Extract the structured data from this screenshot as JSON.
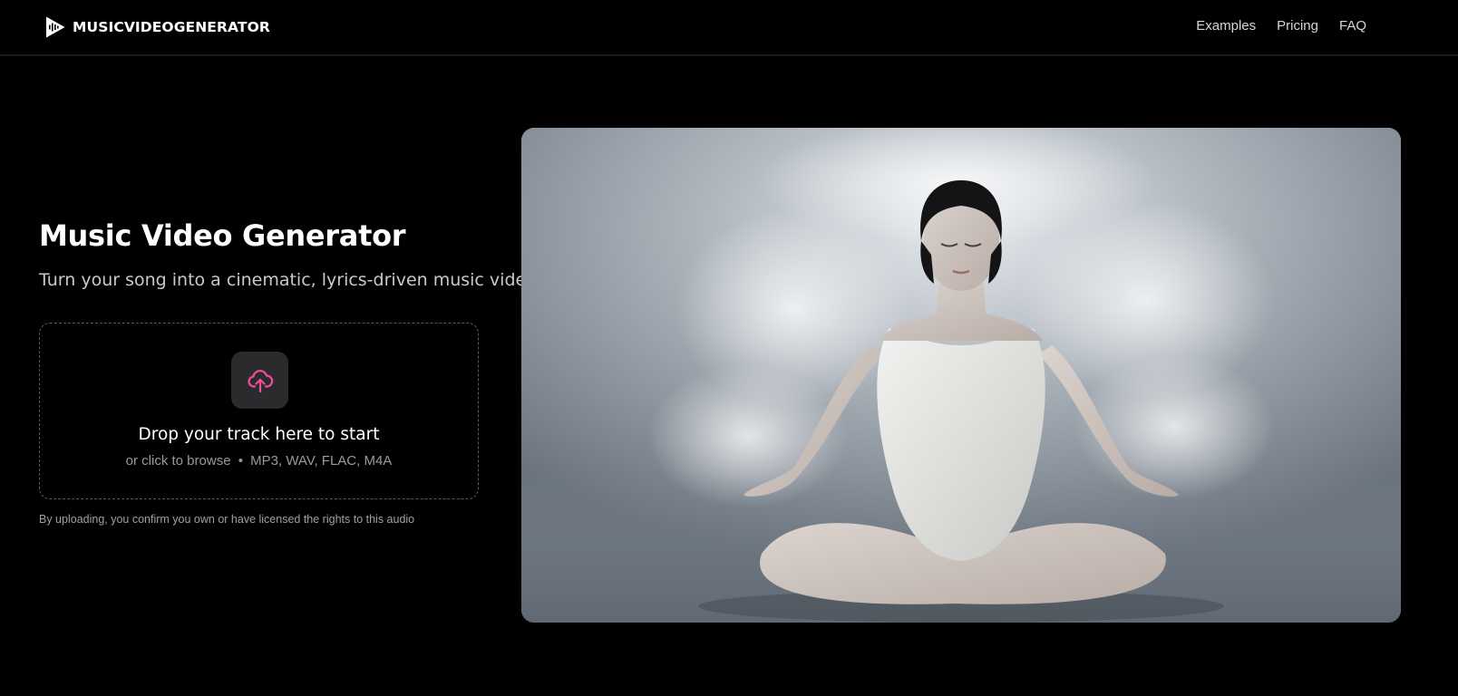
{
  "header": {
    "brand": "MUSICVIDEOGENERATOR",
    "logo_icon": "play-waveform-icon",
    "nav": [
      {
        "label": "Examples"
      },
      {
        "label": "Pricing"
      },
      {
        "label": "FAQ"
      }
    ]
  },
  "hero": {
    "title": "Music Video Generator",
    "subtitle": "Turn your song into a cinematic, lyrics-driven music video",
    "dropzone": {
      "icon": "cloud-upload-icon",
      "title": "Drop your track here to start",
      "browse_text": "or click to browse",
      "separator": "•",
      "formats": "MP3, WAV, FLAC, M4A"
    },
    "disclaimer": "By uploading, you confirm you own or have licensed the rights to this audio",
    "media": {
      "subject": "woman-meditating-image"
    }
  },
  "colors": {
    "background": "#000000",
    "accent": "#ec4f9c",
    "tile": "#2b2b2e",
    "muted_text": "#9a9a9a"
  }
}
